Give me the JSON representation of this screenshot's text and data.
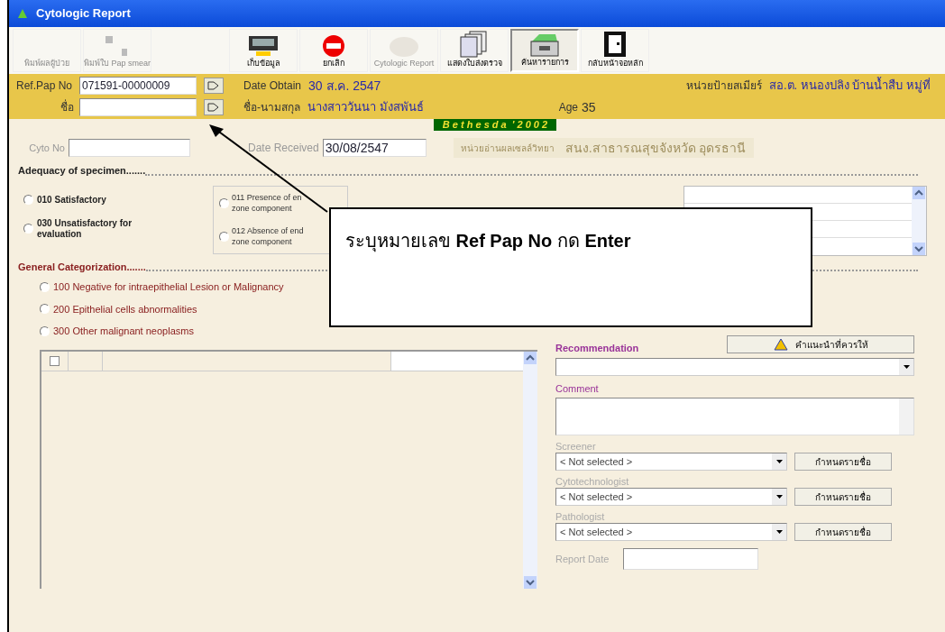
{
  "window": {
    "title": "Cytologic Report"
  },
  "toolbar": [
    {
      "kind": "blank",
      "label": "พิมพ์ผลผู้ป่วย",
      "disabled": true,
      "selected": false
    },
    {
      "kind": "image",
      "label": "พิมพ์ใบ Pap smear",
      "disabled": true,
      "selected": false
    },
    {
      "kind": "spacer"
    },
    {
      "kind": "save",
      "label": "เก็บข้อมูล",
      "disabled": false,
      "selected": false
    },
    {
      "kind": "cancel",
      "label": "ยกเลิก",
      "disabled": false,
      "selected": false
    },
    {
      "kind": "cloud",
      "label": "Cytologic Report",
      "disabled": true,
      "selected": false
    },
    {
      "kind": "docs",
      "label": "แสดงใบส่งตรวจ",
      "disabled": false,
      "selected": false
    },
    {
      "kind": "drawer",
      "label": "ค้นหารายการ",
      "disabled": false,
      "selected": true
    },
    {
      "kind": "exit",
      "label": "กลับหน้าจอหลัก",
      "disabled": false,
      "selected": false
    }
  ],
  "header": {
    "ref_pap_no": {
      "label": "Ref.Pap No",
      "value": "071591-00000009"
    },
    "name": {
      "label": "ชื่อ"
    },
    "date_obtain": {
      "label": "Date Obtain",
      "value": "30 ส.ค. 2547"
    },
    "smear_unit": {
      "label": "หน่วยป้ายสเมียร์",
      "value": "สอ.ต. หนองปลิง บ้านน้ำสืบ หมู่ที่"
    },
    "full_name": {
      "label": "ชื่อ-นามสกุล",
      "value": "นางสาววันนา มังสพันธ์"
    },
    "age": {
      "label": "Age",
      "value": "35"
    }
  },
  "banner": "B e t h e s d a  ' 2 0 0 2",
  "cyto_no": {
    "label": "Cyto No"
  },
  "date_received": {
    "label": "Date Received",
    "value": "30/08/2547"
  },
  "reading_unit": {
    "label": "หน่วยอ่านผลเซลล์วิทยา",
    "value": "สนง.สาธารณสุขจังหวัด อุดรธานี"
  },
  "adequacy": {
    "title": "Adequacy of specimen.......",
    "options": [
      {
        "label": "010 Satisfactory",
        "selected": false
      },
      {
        "label": "030 Unsatisfactory for evaluation",
        "selected": false
      }
    ],
    "sub_options": [
      {
        "label": "011 Presence of en",
        "note": "zone component",
        "selected": false
      },
      {
        "label": "012 Absence of end",
        "note": "zone component",
        "selected": false
      }
    ]
  },
  "categorization": {
    "title": "General Categorization.......",
    "options": [
      {
        "label": "100 Negative for intraepithelial Lesion or Malignancy",
        "selected": false
      },
      {
        "label": "200 Epithelial cells abnormalities",
        "selected": false
      },
      {
        "label": "300 Other malignant neoplasms",
        "selected": false
      }
    ]
  },
  "grid": {
    "header_checked": false
  },
  "recommendation": {
    "label": "Recommendation",
    "button": "คำแนะนำที่ควรให้"
  },
  "comment": {
    "label": "Comment"
  },
  "staff": [
    {
      "label": "Screener",
      "value": "< Not selected >",
      "button": "กำหนดรายชื่อ"
    },
    {
      "label": "Cytotechnologist",
      "value": "< Not selected >",
      "button": "กำหนดรายชื่อ"
    },
    {
      "label": "Pathologist",
      "value": "< Not selected >",
      "button": "กำหนดรายชื่อ"
    }
  ],
  "report_date": {
    "label": "Report Date"
  },
  "callout": "ระบุหมายเลข **Ref Pap No** กด **Enter**"
}
